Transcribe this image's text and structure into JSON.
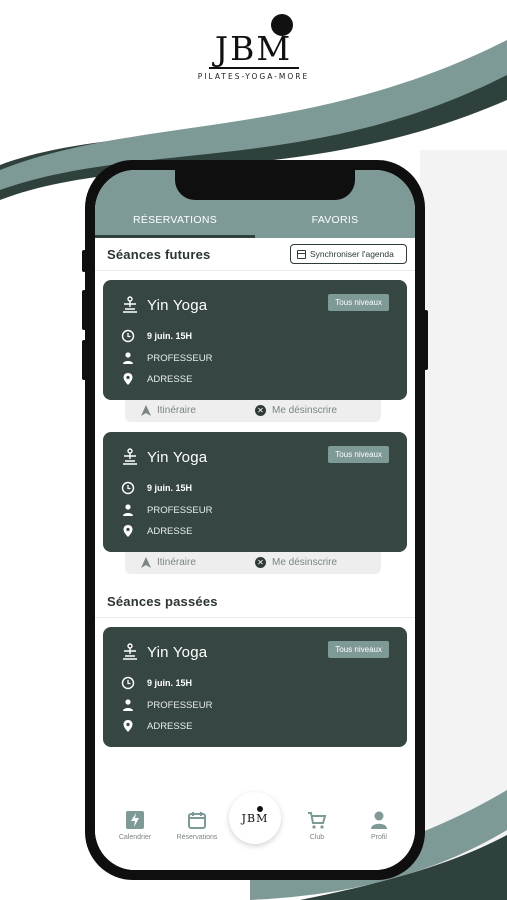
{
  "brand": {
    "logo_text": "JBM",
    "tagline": "PILATES-YOGA-MORE"
  },
  "tabs": [
    {
      "label": "RÉSERVATIONS",
      "active": true
    },
    {
      "label": "FAVORIS",
      "active": false
    }
  ],
  "sections": {
    "future_title": "Séances futures",
    "past_title": "Séances passées"
  },
  "sync_label": "Synchroniser l'agenda",
  "future_sessions": [
    {
      "title": "Yin Yoga",
      "badge": "Tous niveaux",
      "date": "9 juin. 15H",
      "teacher": "PROFESSEUR",
      "address": "ADRESSE"
    },
    {
      "title": "Yin Yoga",
      "badge": "Tous niveaux",
      "date": "9 juin. 15H",
      "teacher": "PROFESSEUR",
      "address": "ADRESSE"
    }
  ],
  "past_sessions": [
    {
      "title": "Yin Yoga",
      "badge": "Tous niveaux",
      "date": "9 juin. 15H",
      "teacher": "PROFESSEUR",
      "address": "ADRESSE"
    }
  ],
  "actions": {
    "itinerary": "Itinéraire",
    "unsubscribe": "Me désinscrire"
  },
  "bottom_nav": [
    {
      "label": "Calendrier",
      "icon": "lightning-icon"
    },
    {
      "label": "Réservations",
      "icon": "calendar-icon"
    },
    {
      "label": "Club",
      "icon": "cart-icon"
    },
    {
      "label": "Profil",
      "icon": "user-icon"
    }
  ],
  "colors": {
    "accent": "#7e9a97",
    "card": "#364643",
    "dark": "#2f413d"
  }
}
